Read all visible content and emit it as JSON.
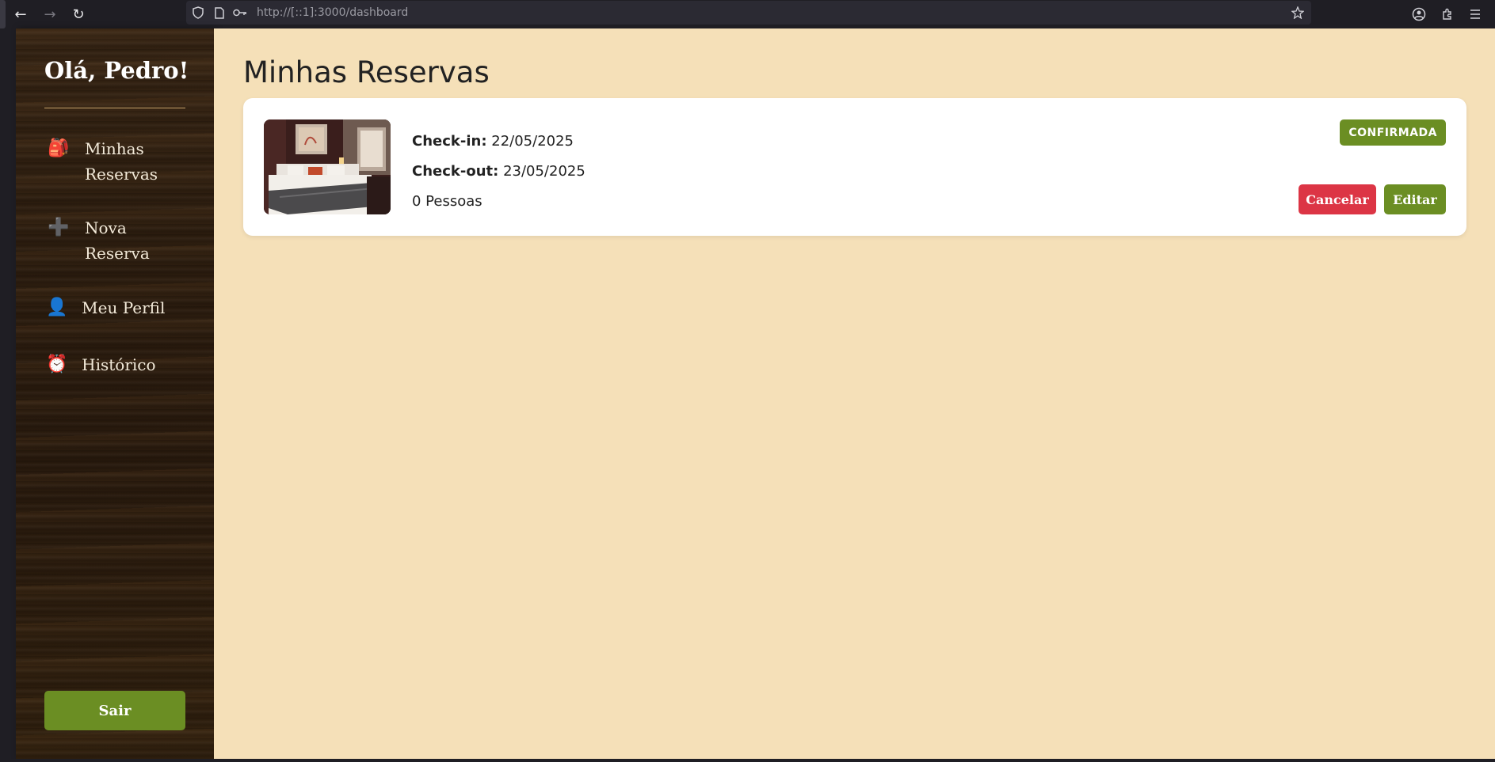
{
  "browser": {
    "url": "http://[::1]:3000/dashboard"
  },
  "sidebar": {
    "greeting": "Olá, Pedro!",
    "items": [
      {
        "icon": "🎒",
        "icon_name": "backpack-icon",
        "label": "Minhas Reservas"
      },
      {
        "icon": "➕",
        "icon_name": "plus-icon",
        "label": "Nova Reserva"
      },
      {
        "icon": "👤",
        "icon_name": "user-icon",
        "label": "Meu Perfil"
      },
      {
        "icon": "⏰",
        "icon_name": "alarm-clock-icon",
        "label": "Histórico"
      }
    ],
    "logout_label": "Sair"
  },
  "main": {
    "title": "Minhas Reservas",
    "reservations": [
      {
        "checkin_label": "Check-in:",
        "checkin": "22/05/2025",
        "checkout_label": "Check-out:",
        "checkout": "23/05/2025",
        "guests": "0 Pessoas",
        "status": "CONFIRMADA",
        "cancel_label": "Cancelar",
        "edit_label": "Editar"
      }
    ]
  },
  "colors": {
    "accent_green": "#6b8e23",
    "danger_red": "#dc3545",
    "main_bg": "#f5e0b8"
  }
}
